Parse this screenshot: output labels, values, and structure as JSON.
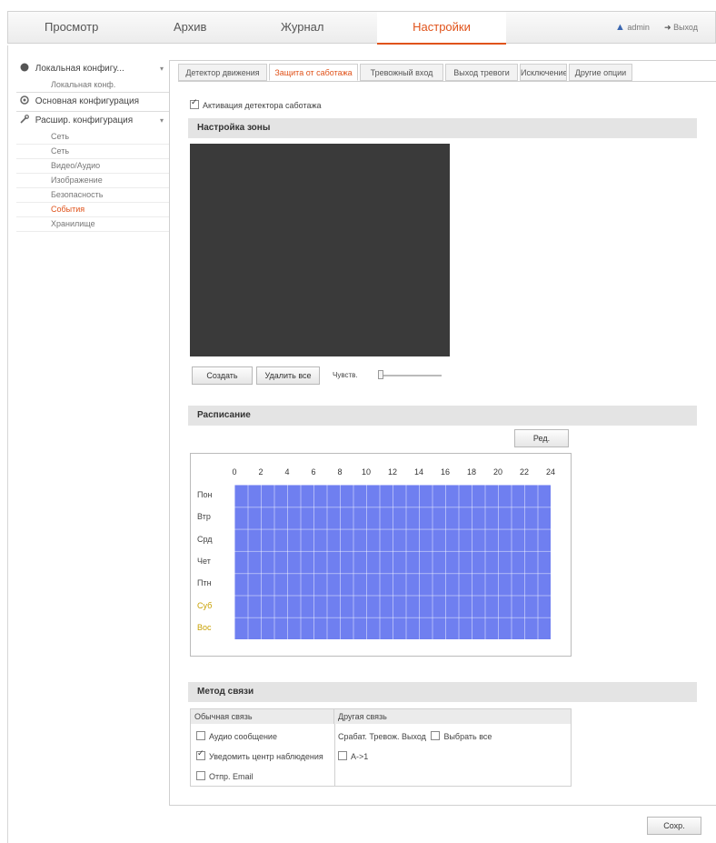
{
  "topnav": {
    "items": [
      "Просмотр",
      "Архив",
      "Журнал",
      "Настройки"
    ],
    "active_index": 3,
    "user_label": "admin",
    "logout_label": "Выход"
  },
  "sidebar": {
    "local": "Локальная конфигу...",
    "local_sub": "Локальная конф.",
    "basic": "Основная конфигурация",
    "advanced": "Расшир. конфигурация",
    "adv_items": [
      "Сеть",
      "Сеть",
      "Видео/Аудио",
      "Изображение",
      "Безопасность",
      "События",
      "Хранилище"
    ],
    "active_item": "События"
  },
  "tabs": {
    "items": [
      "Детектор движения",
      "Защита от саботажа",
      "Тревожный вход",
      "Выход тревоги",
      "Исключение",
      "Другие опции"
    ],
    "active_index": 1
  },
  "enable_label": "Активация детектора саботажа",
  "enable_checked": true,
  "area_settings": {
    "heading": "Настройка зоны",
    "draw_button": "Создать",
    "clear_button": "Удалить все",
    "sensitivity_label": "Чувств."
  },
  "schedule": {
    "heading": "Расписание",
    "edit_button": "Ред.",
    "hours": [
      "0",
      "2",
      "4",
      "6",
      "8",
      "10",
      "12",
      "14",
      "16",
      "18",
      "20",
      "22",
      "24"
    ],
    "days": [
      "Пон",
      "Втр",
      "Срд",
      "Чет",
      "Птн",
      "Суб",
      "Вос"
    ],
    "weekend_color": "#c8a000",
    "fill_color": "#6f7ff0"
  },
  "linkage": {
    "heading": "Метод связи",
    "normal_header": "Обычная связь",
    "other_header": "Другая связь",
    "normal": [
      {
        "label": "Аудио сообщение",
        "checked": false
      },
      {
        "label": "Уведомить центр наблюдения",
        "checked": true
      },
      {
        "label": "Отпр. Email",
        "checked": false
      }
    ],
    "other_line1": "Срабат. Тревож. Выход",
    "select_all": "Выбрать все",
    "output_a1": "A->1"
  },
  "save_button": "Сохр."
}
